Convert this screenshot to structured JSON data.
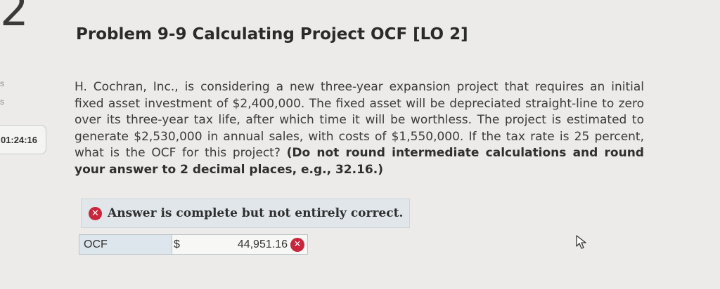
{
  "page_number": "2",
  "timer": "01:24:16",
  "problem": {
    "title": "Problem 9-9 Calculating Project OCF [LO 2]",
    "text": "H. Cochran, Inc., is considering a new three-year expansion project that requires an initial fixed asset investment of $2,400,000. The fixed asset will be depreciated straight-line to zero over its three-year tax life, after which time it will be worthless. The project is estimated to generate $2,530,000 in annual sales, with costs of $1,550,000. If the tax rate is 25 percent, what is the OCF for this project?",
    "instruction": "(Do not round intermediate calculations and round your answer to 2 decimal places, e.g., 32.16.)"
  },
  "feedback": {
    "message": "Answer is complete but not entirely correct.",
    "status_icon": "x-circle-icon",
    "status_color": "#c9263b"
  },
  "answer": {
    "label": "OCF",
    "currency": "$",
    "value": "44,951.16",
    "status_icon": "x-circle-icon"
  },
  "colors": {
    "background": "#ecebe9",
    "banner_background": "#e0e6e9",
    "label_background": "#dde6ec",
    "error_red": "#c9263b"
  }
}
